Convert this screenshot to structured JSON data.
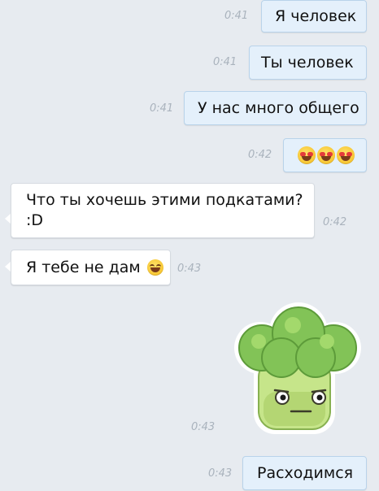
{
  "messages": [
    {
      "text": "Я человек",
      "time": "0:41"
    },
    {
      "text": "Ты человек",
      "time": "0:41"
    },
    {
      "text": "У нас много общего",
      "time": "0:41"
    },
    {
      "emoji": "heart-eyes x3",
      "time": "0:42"
    },
    {
      "text_line1": "Что ты хочешь этими подкатами?",
      "text_line2": ":D",
      "time": "0:42"
    },
    {
      "text": "Я тебе не дам",
      "emoji": "grinning-squint",
      "time": "0:43"
    },
    {
      "sticker": "broccoli-sticker",
      "time": "0:43"
    },
    {
      "text": "Расходимся",
      "time": "0:43"
    }
  ]
}
